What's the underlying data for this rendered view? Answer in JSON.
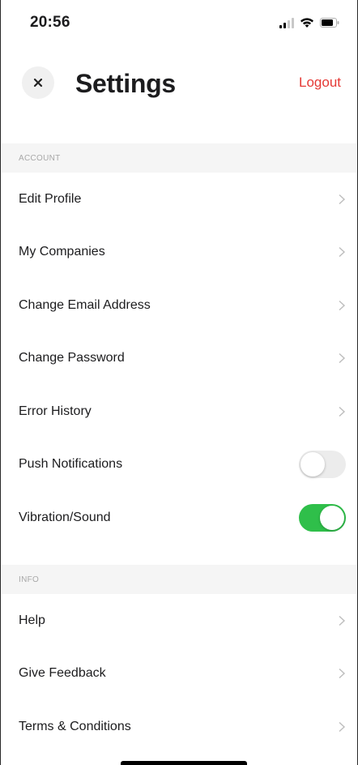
{
  "status_bar": {
    "time": "20:56"
  },
  "header": {
    "title": "Settings",
    "logout_label": "Logout",
    "close_label": "×"
  },
  "sections": {
    "account": {
      "title": "ACCOUNT",
      "items": [
        {
          "label": "Edit Profile"
        },
        {
          "label": "My Companies"
        },
        {
          "label": "Change Email Address"
        },
        {
          "label": "Change Password"
        },
        {
          "label": "Error History"
        },
        {
          "label": "Push Notifications",
          "toggle": false
        },
        {
          "label": "Vibration/Sound",
          "toggle": true
        }
      ]
    },
    "info": {
      "title": "INFO",
      "items": [
        {
          "label": "Help"
        },
        {
          "label": "Give Feedback"
        },
        {
          "label": "Terms & Conditions"
        }
      ]
    }
  },
  "colors": {
    "accent_red": "#e53935",
    "toggle_on": "#2fbf4a",
    "toggle_off": "#ececec"
  }
}
